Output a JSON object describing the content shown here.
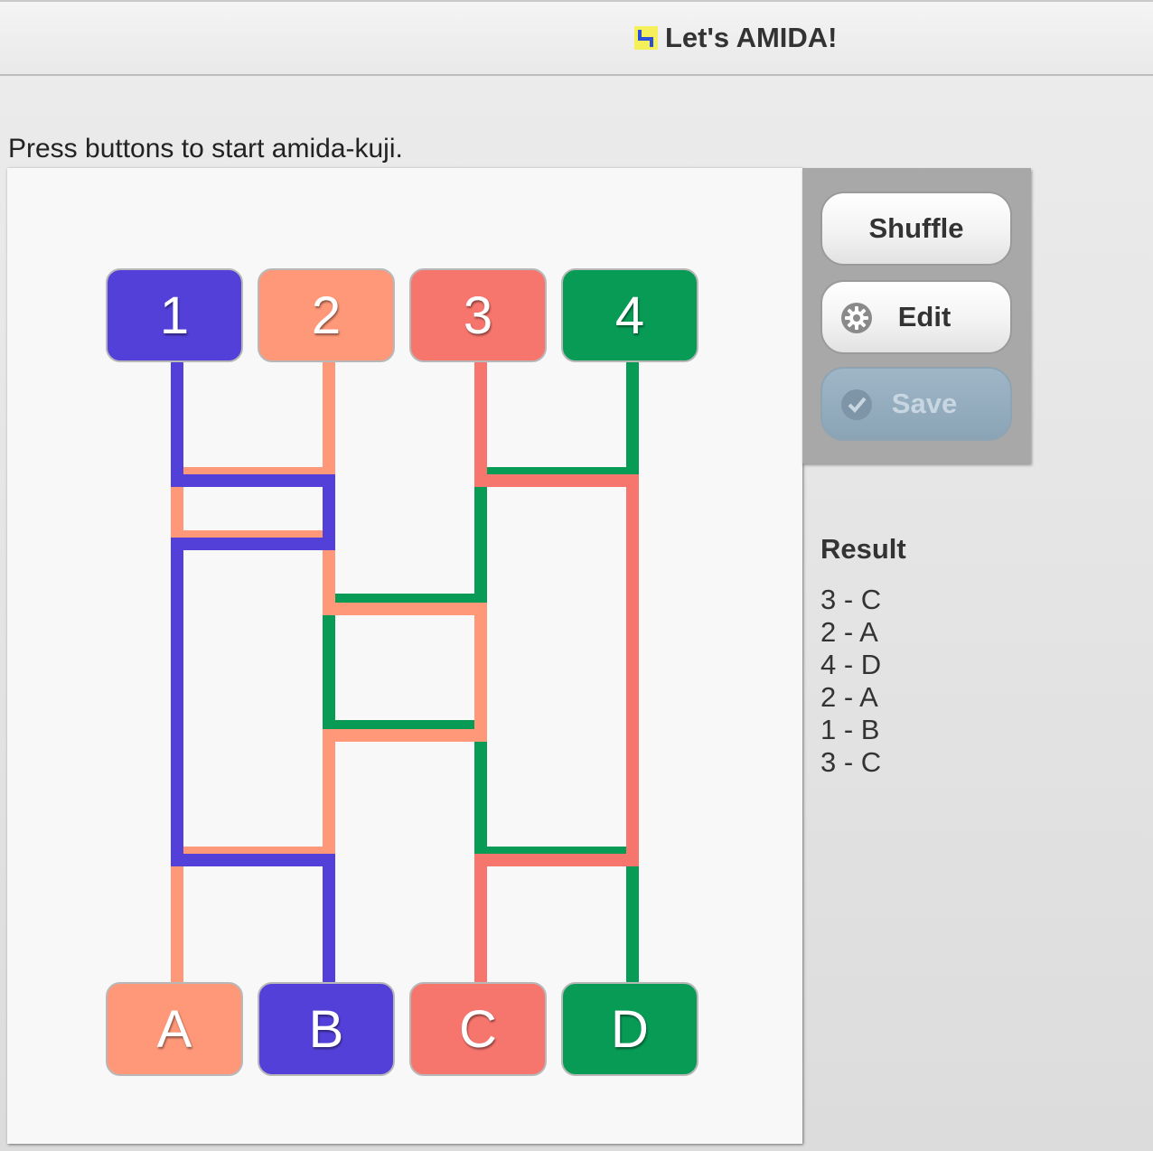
{
  "window": {
    "title": "Let's AMIDA!",
    "icon": "amida-app-icon"
  },
  "instruction": "Press buttons to start amida-kuji.",
  "board": {
    "starts": [
      {
        "label": "1",
        "color": "#5340d8"
      },
      {
        "label": "2",
        "color": "#fe9878"
      },
      {
        "label": "3",
        "color": "#f6766e"
      },
      {
        "label": "4",
        "color": "#079b55"
      }
    ],
    "goals": [
      {
        "label": "A",
        "color": "#fe9878"
      },
      {
        "label": "B",
        "color": "#5340d8"
      },
      {
        "label": "C",
        "color": "#f6766e"
      },
      {
        "label": "D",
        "color": "#079b55"
      }
    ]
  },
  "controls": {
    "shuffle_label": "Shuffle",
    "edit_label": "Edit",
    "edit_icon": "gear-icon",
    "save_label": "Save",
    "save_icon": "checkmark-icon",
    "save_enabled": false
  },
  "result": {
    "title": "Result",
    "items": [
      "3 - C",
      "2 - A",
      "4 - D",
      "2 - A",
      "1 - B",
      "3 - C"
    ]
  }
}
